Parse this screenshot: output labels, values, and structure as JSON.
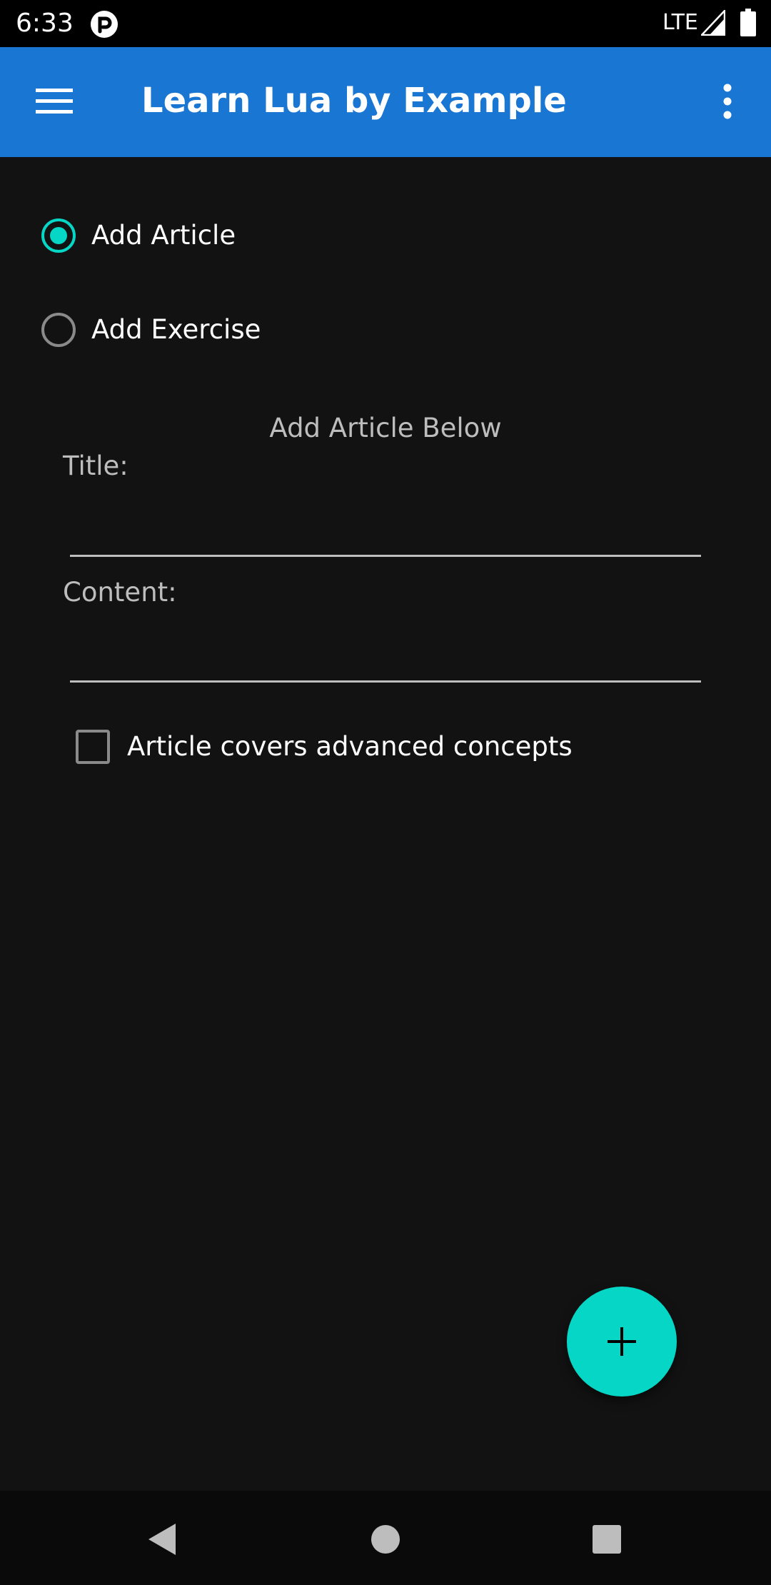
{
  "status_bar": {
    "time": "6:33",
    "network": "LTE",
    "app_icon": "p-circle-icon",
    "signal_icon": "signal-icon",
    "battery_icon": "battery-icon"
  },
  "app_bar": {
    "title": "Learn Lua by Example",
    "menu_icon": "hamburger-menu-icon",
    "overflow_icon": "more-vert-icon",
    "color": "#1976D2"
  },
  "form": {
    "radio_options": [
      {
        "label": "Add Article",
        "selected": true
      },
      {
        "label": "Add Exercise",
        "selected": false
      }
    ],
    "heading": "Add Article Below",
    "title_label": "Title:",
    "title_value": "",
    "content_label": "Content:",
    "content_value": "",
    "advanced_checkbox_label": "Article covers advanced concepts",
    "advanced_checked": false,
    "accent_color": "#05D6C5"
  },
  "fab": {
    "icon": "plus-icon"
  },
  "nav_bar": {
    "back_icon": "back-triangle-icon",
    "home_icon": "home-circle-icon",
    "recents_icon": "recents-square-icon"
  }
}
